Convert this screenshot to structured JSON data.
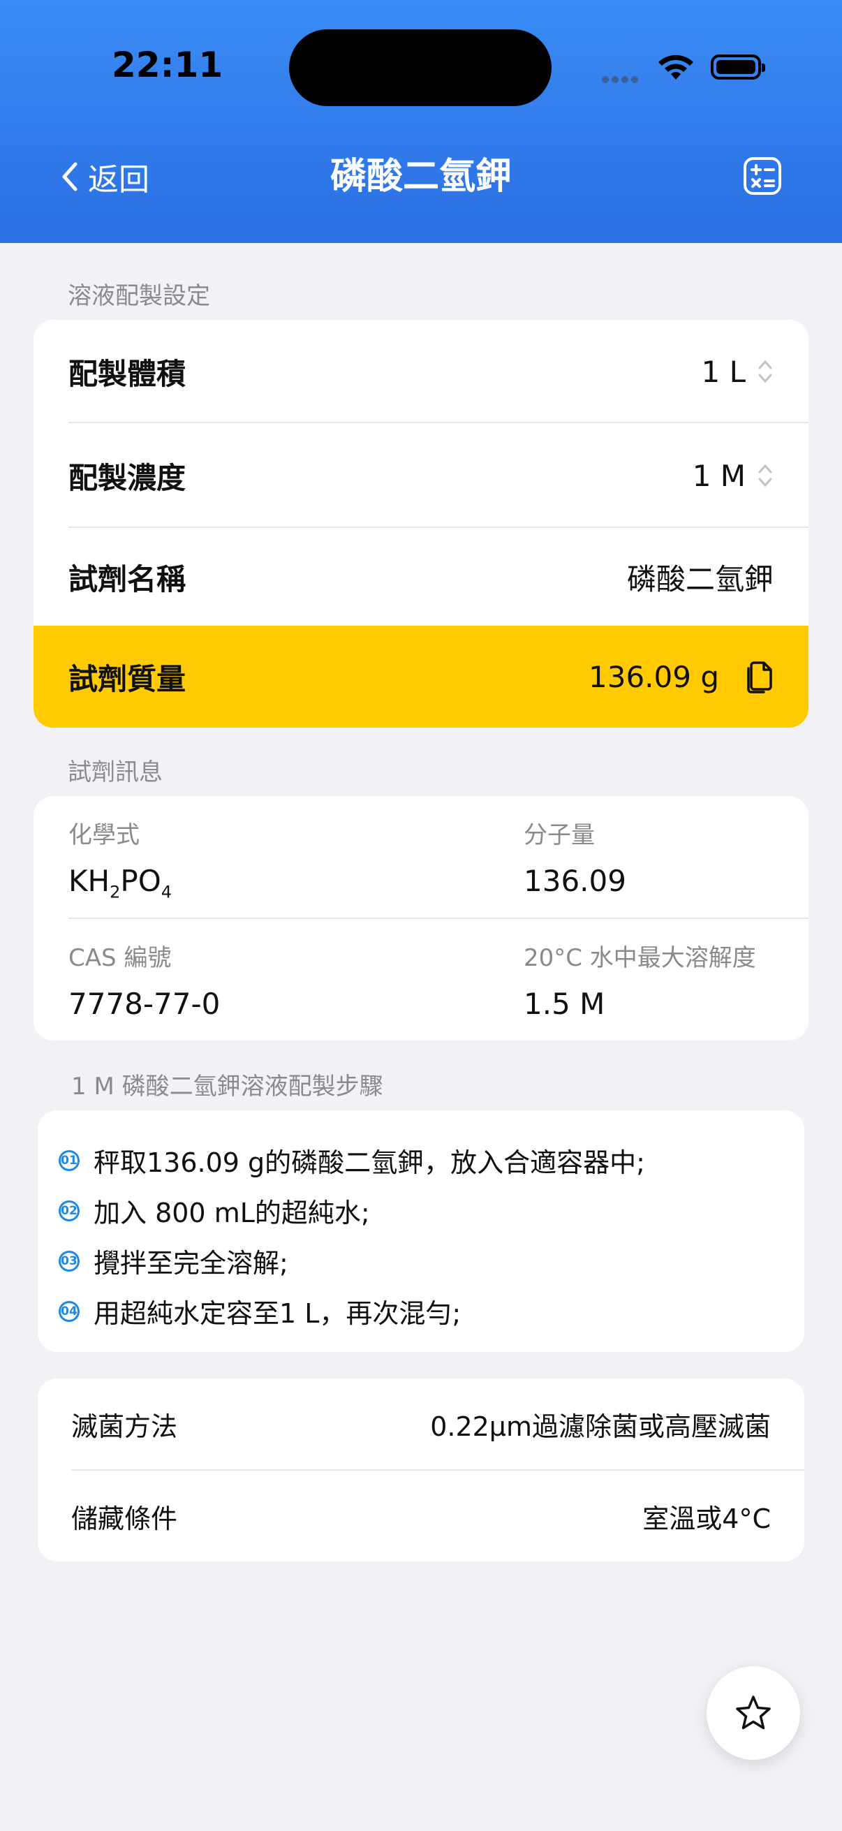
{
  "status_bar": {
    "time": "22:11"
  },
  "nav": {
    "back_label": "返回",
    "title": "磷酸二氫鉀"
  },
  "settings_section": {
    "label": "溶液配製設定",
    "volume_label": "配製體積",
    "volume_value": "1 L",
    "concentration_label": "配製濃度",
    "concentration_value": "1 M",
    "reagent_name_label": "試劑名稱",
    "reagent_name_value": "磷酸二氫鉀",
    "mass_label": "試劑質量",
    "mass_value": "136.09 g"
  },
  "info_section": {
    "label": "試劑訊息",
    "formula_label": "化學式",
    "formula_value": {
      "p1": "KH",
      "sub1": "2",
      "p2": "PO",
      "sub2": "4"
    },
    "mw_label": "分子量",
    "mw_value": "136.09",
    "cas_label": "CAS 編號",
    "cas_value": "7778-77-0",
    "solubility_label": "20°C 水中最大溶解度",
    "solubility_value": "1.5 M"
  },
  "steps_section": {
    "label": "1 M 磷酸二氫鉀溶液配製步驟",
    "steps": [
      {
        "num": "01",
        "text": "秤取136.09 g的磷酸二氫鉀，放入合適容器中;"
      },
      {
        "num": "02",
        "text": "加入 800 mL的超純水;"
      },
      {
        "num": "03",
        "text": "攪拌至完全溶解;"
      },
      {
        "num": "04",
        "text": "用超純水定容至1 L，再次混勻;"
      }
    ]
  },
  "extra": {
    "sterilization_label": "滅菌方法",
    "sterilization_value": "0.22μm過濾除菌或高壓滅菌",
    "storage_label": "儲藏條件",
    "storage_value": "室溫或4°C"
  },
  "colors": {
    "header": "#2f7bec",
    "highlight": "#ffcb00",
    "step_accent": "#1e88e5",
    "background": "#f1f1f6"
  },
  "icons": {
    "back": "chevron-left-icon",
    "calc": "calculator-icon",
    "copy": "copy-icon",
    "favorite": "star-icon"
  }
}
